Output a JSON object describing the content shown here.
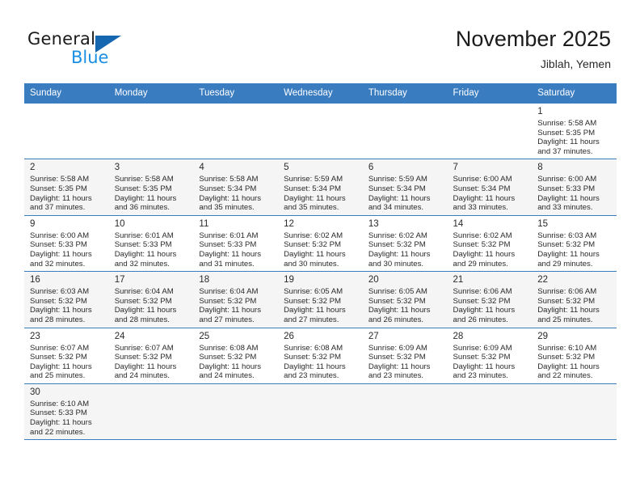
{
  "brand": {
    "word1": "General",
    "word2": "Blue",
    "triangle_color": "#1667b2",
    "blue_color": "#1a8fe3"
  },
  "header": {
    "title": "November 2025",
    "subtitle": "Jiblah, Yemen",
    "header_bg": "#3a7cc0",
    "header_text_color": "#ffffff"
  },
  "weekdays": [
    "Sunday",
    "Monday",
    "Tuesday",
    "Wednesday",
    "Thursday",
    "Friday",
    "Saturday"
  ],
  "labels": {
    "sunrise": "Sunrise:",
    "sunset": "Sunset:",
    "daylight": "Daylight:"
  },
  "weeks": [
    [
      {
        "day": "",
        "sunrise": "",
        "sunset": "",
        "daylight": "",
        "empty": true
      },
      {
        "day": "",
        "sunrise": "",
        "sunset": "",
        "daylight": "",
        "empty": true
      },
      {
        "day": "",
        "sunrise": "",
        "sunset": "",
        "daylight": "",
        "empty": true
      },
      {
        "day": "",
        "sunrise": "",
        "sunset": "",
        "daylight": "",
        "empty": true
      },
      {
        "day": "",
        "sunrise": "",
        "sunset": "",
        "daylight": "",
        "empty": true
      },
      {
        "day": "",
        "sunrise": "",
        "sunset": "",
        "daylight": "",
        "empty": true
      },
      {
        "day": "1",
        "sunrise": "Sunrise: 5:58 AM",
        "sunset": "Sunset: 5:35 PM",
        "daylight": "Daylight: 11 hours and 37 minutes.",
        "empty": false
      }
    ],
    [
      {
        "day": "2",
        "sunrise": "Sunrise: 5:58 AM",
        "sunset": "Sunset: 5:35 PM",
        "daylight": "Daylight: 11 hours and 37 minutes.",
        "empty": false
      },
      {
        "day": "3",
        "sunrise": "Sunrise: 5:58 AM",
        "sunset": "Sunset: 5:35 PM",
        "daylight": "Daylight: 11 hours and 36 minutes.",
        "empty": false
      },
      {
        "day": "4",
        "sunrise": "Sunrise: 5:58 AM",
        "sunset": "Sunset: 5:34 PM",
        "daylight": "Daylight: 11 hours and 35 minutes.",
        "empty": false
      },
      {
        "day": "5",
        "sunrise": "Sunrise: 5:59 AM",
        "sunset": "Sunset: 5:34 PM",
        "daylight": "Daylight: 11 hours and 35 minutes.",
        "empty": false
      },
      {
        "day": "6",
        "sunrise": "Sunrise: 5:59 AM",
        "sunset": "Sunset: 5:34 PM",
        "daylight": "Daylight: 11 hours and 34 minutes.",
        "empty": false
      },
      {
        "day": "7",
        "sunrise": "Sunrise: 6:00 AM",
        "sunset": "Sunset: 5:34 PM",
        "daylight": "Daylight: 11 hours and 33 minutes.",
        "empty": false
      },
      {
        "day": "8",
        "sunrise": "Sunrise: 6:00 AM",
        "sunset": "Sunset: 5:33 PM",
        "daylight": "Daylight: 11 hours and 33 minutes.",
        "empty": false
      }
    ],
    [
      {
        "day": "9",
        "sunrise": "Sunrise: 6:00 AM",
        "sunset": "Sunset: 5:33 PM",
        "daylight": "Daylight: 11 hours and 32 minutes.",
        "empty": false
      },
      {
        "day": "10",
        "sunrise": "Sunrise: 6:01 AM",
        "sunset": "Sunset: 5:33 PM",
        "daylight": "Daylight: 11 hours and 32 minutes.",
        "empty": false
      },
      {
        "day": "11",
        "sunrise": "Sunrise: 6:01 AM",
        "sunset": "Sunset: 5:33 PM",
        "daylight": "Daylight: 11 hours and 31 minutes.",
        "empty": false
      },
      {
        "day": "12",
        "sunrise": "Sunrise: 6:02 AM",
        "sunset": "Sunset: 5:32 PM",
        "daylight": "Daylight: 11 hours and 30 minutes.",
        "empty": false
      },
      {
        "day": "13",
        "sunrise": "Sunrise: 6:02 AM",
        "sunset": "Sunset: 5:32 PM",
        "daylight": "Daylight: 11 hours and 30 minutes.",
        "empty": false
      },
      {
        "day": "14",
        "sunrise": "Sunrise: 6:02 AM",
        "sunset": "Sunset: 5:32 PM",
        "daylight": "Daylight: 11 hours and 29 minutes.",
        "empty": false
      },
      {
        "day": "15",
        "sunrise": "Sunrise: 6:03 AM",
        "sunset": "Sunset: 5:32 PM",
        "daylight": "Daylight: 11 hours and 29 minutes.",
        "empty": false
      }
    ],
    [
      {
        "day": "16",
        "sunrise": "Sunrise: 6:03 AM",
        "sunset": "Sunset: 5:32 PM",
        "daylight": "Daylight: 11 hours and 28 minutes.",
        "empty": false
      },
      {
        "day": "17",
        "sunrise": "Sunrise: 6:04 AM",
        "sunset": "Sunset: 5:32 PM",
        "daylight": "Daylight: 11 hours and 28 minutes.",
        "empty": false
      },
      {
        "day": "18",
        "sunrise": "Sunrise: 6:04 AM",
        "sunset": "Sunset: 5:32 PM",
        "daylight": "Daylight: 11 hours and 27 minutes.",
        "empty": false
      },
      {
        "day": "19",
        "sunrise": "Sunrise: 6:05 AM",
        "sunset": "Sunset: 5:32 PM",
        "daylight": "Daylight: 11 hours and 27 minutes.",
        "empty": false
      },
      {
        "day": "20",
        "sunrise": "Sunrise: 6:05 AM",
        "sunset": "Sunset: 5:32 PM",
        "daylight": "Daylight: 11 hours and 26 minutes.",
        "empty": false
      },
      {
        "day": "21",
        "sunrise": "Sunrise: 6:06 AM",
        "sunset": "Sunset: 5:32 PM",
        "daylight": "Daylight: 11 hours and 26 minutes.",
        "empty": false
      },
      {
        "day": "22",
        "sunrise": "Sunrise: 6:06 AM",
        "sunset": "Sunset: 5:32 PM",
        "daylight": "Daylight: 11 hours and 25 minutes.",
        "empty": false
      }
    ],
    [
      {
        "day": "23",
        "sunrise": "Sunrise: 6:07 AM",
        "sunset": "Sunset: 5:32 PM",
        "daylight": "Daylight: 11 hours and 25 minutes.",
        "empty": false
      },
      {
        "day": "24",
        "sunrise": "Sunrise: 6:07 AM",
        "sunset": "Sunset: 5:32 PM",
        "daylight": "Daylight: 11 hours and 24 minutes.",
        "empty": false
      },
      {
        "day": "25",
        "sunrise": "Sunrise: 6:08 AM",
        "sunset": "Sunset: 5:32 PM",
        "daylight": "Daylight: 11 hours and 24 minutes.",
        "empty": false
      },
      {
        "day": "26",
        "sunrise": "Sunrise: 6:08 AM",
        "sunset": "Sunset: 5:32 PM",
        "daylight": "Daylight: 11 hours and 23 minutes.",
        "empty": false
      },
      {
        "day": "27",
        "sunrise": "Sunrise: 6:09 AM",
        "sunset": "Sunset: 5:32 PM",
        "daylight": "Daylight: 11 hours and 23 minutes.",
        "empty": false
      },
      {
        "day": "28",
        "sunrise": "Sunrise: 6:09 AM",
        "sunset": "Sunset: 5:32 PM",
        "daylight": "Daylight: 11 hours and 23 minutes.",
        "empty": false
      },
      {
        "day": "29",
        "sunrise": "Sunrise: 6:10 AM",
        "sunset": "Sunset: 5:32 PM",
        "daylight": "Daylight: 11 hours and 22 minutes.",
        "empty": false
      }
    ],
    [
      {
        "day": "30",
        "sunrise": "Sunrise: 6:10 AM",
        "sunset": "Sunset: 5:33 PM",
        "daylight": "Daylight: 11 hours and 22 minutes.",
        "empty": false
      },
      {
        "day": "",
        "sunrise": "",
        "sunset": "",
        "daylight": "",
        "empty": true
      },
      {
        "day": "",
        "sunrise": "",
        "sunset": "",
        "daylight": "",
        "empty": true
      },
      {
        "day": "",
        "sunrise": "",
        "sunset": "",
        "daylight": "",
        "empty": true
      },
      {
        "day": "",
        "sunrise": "",
        "sunset": "",
        "daylight": "",
        "empty": true
      },
      {
        "day": "",
        "sunrise": "",
        "sunset": "",
        "daylight": "",
        "empty": true
      },
      {
        "day": "",
        "sunrise": "",
        "sunset": "",
        "daylight": "",
        "empty": true
      }
    ]
  ]
}
